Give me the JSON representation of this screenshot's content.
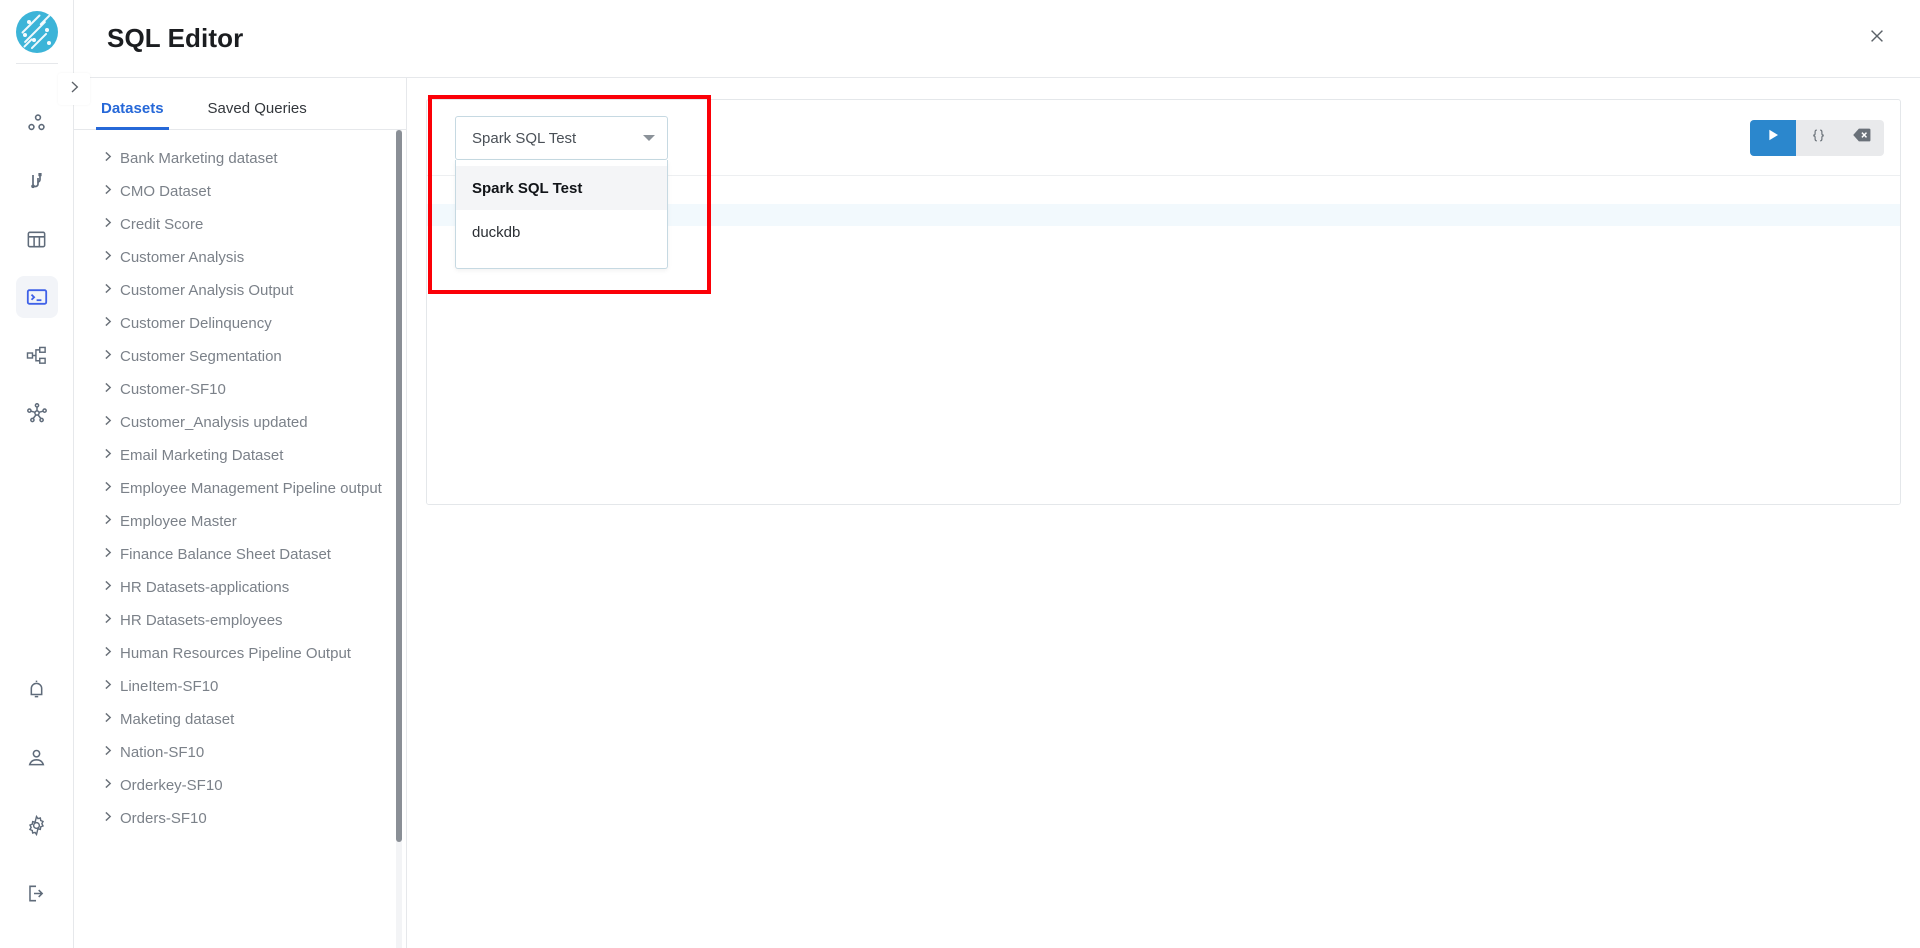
{
  "app": {
    "logo_icon": "circuit-globe-logo",
    "rail_items_top": [
      {
        "name": "projects",
        "icon": "nodes-icon"
      },
      {
        "name": "connections",
        "icon": "connector-icon"
      },
      {
        "name": "tables",
        "icon": "table-icon"
      },
      {
        "name": "sql-editor",
        "icon": "terminal-icon",
        "active": true
      },
      {
        "name": "pipelines",
        "icon": "pipeline-icon"
      },
      {
        "name": "lineage",
        "icon": "network-icon"
      }
    ],
    "rail_items_bottom": [
      {
        "name": "notifications",
        "icon": "bell-icon"
      },
      {
        "name": "account",
        "icon": "person-icon"
      },
      {
        "name": "settings",
        "icon": "gear-icon"
      },
      {
        "name": "logout",
        "icon": "logout-icon"
      }
    ]
  },
  "header": {
    "title": "SQL Editor",
    "close_icon": "close-icon",
    "collapse_icon": "chevron-right-icon"
  },
  "left_panel": {
    "tabs": [
      {
        "label": "Datasets",
        "active": true
      },
      {
        "label": "Saved Queries",
        "active": false
      }
    ],
    "datasets": [
      "Bank Marketing dataset",
      "CMO Dataset",
      "Credit Score",
      "Customer Analysis",
      "Customer Analysis Output",
      "Customer Delinquency",
      "Customer Segmentation",
      "Customer-SF10",
      "Customer_Analysis updated",
      "Email Marketing Dataset",
      "Employee Management Pipeline output",
      "Employee Master",
      "Finance Balance Sheet Dataset",
      "HR Datasets-applications",
      "HR Datasets-employees",
      "Human Resources Pipeline Output",
      "LineItem-SF10",
      "Maketing dataset",
      "Nation-SF10",
      "Orderkey-SF10",
      "Orders-SF10"
    ]
  },
  "editor": {
    "database_select": {
      "value": "Spark SQL Test",
      "expanded": true,
      "caret_icon": "chevron-down-icon",
      "options": [
        {
          "label": "Spark SQL Test",
          "selected": true
        },
        {
          "label": "duckdb",
          "selected": false
        }
      ]
    },
    "toolbar": {
      "run_label": "",
      "run_icon": "play-icon",
      "format_label": "{ }",
      "format_icon": "braces-icon",
      "clear_icon": "backspace-icon"
    }
  },
  "colors": {
    "accent_blue": "#2668d8",
    "run_blue": "#2b87cd",
    "logo_cyan": "#3cb4d8",
    "annotation_red": "#fb0007",
    "active_line": "#f2f9fd"
  }
}
